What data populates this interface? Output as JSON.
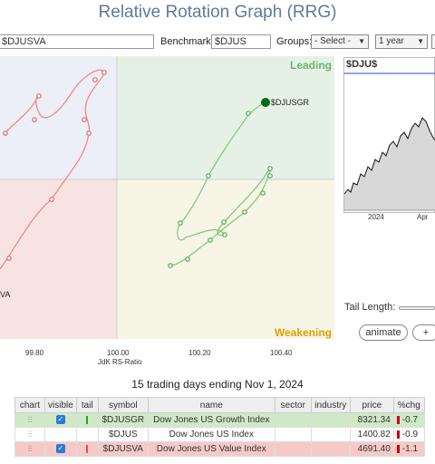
{
  "title": "Relative Rotation Graph (RRG)",
  "controls": {
    "symbols_value": "$DJUSVA",
    "benchmark_label": "Benchmark:",
    "benchmark_value": "$DJUS",
    "groups_label": "Groups:",
    "groups_value": "- Select -",
    "period_value": "1 year"
  },
  "quadrants": {
    "leading": "Leading",
    "weakening": "Weakening",
    "leading_color": "#6db36d",
    "weakening_color": "#d9a100"
  },
  "rrg": {
    "x_ticks": [
      "99.80",
      "100.00",
      "100.20",
      "100.40"
    ],
    "x_axis_label": "JdK RS-Ratio",
    "series_labels": {
      "growth": "$DJUSGR",
      "value": "VA"
    },
    "growth_color": "#5cb85c",
    "value_color": "#e86a6a"
  },
  "price_panel": {
    "symbol": "$DJU$",
    "x_ticks": [
      "2024",
      "Apr"
    ]
  },
  "tail_length_label": "Tail Length:",
  "buttons": {
    "animate": "animate",
    "plus": "+"
  },
  "summary": "15 trading days ending Nov 1, 2024",
  "table": {
    "headers": [
      "chart",
      "visible",
      "tail",
      "symbol",
      "name",
      "sector",
      "industry",
      "price",
      "%chg"
    ],
    "rows": [
      {
        "symbol": "$DJUSGR",
        "name": "Dow Jones US Growth Index",
        "sector": "",
        "industry": "",
        "price": "8321.34",
        "chg": "-0.7",
        "visible": true,
        "tail_color": "#2e9e2e"
      },
      {
        "symbol": "$DJUS",
        "name": "Dow Jones US Index",
        "sector": "",
        "industry": "",
        "price": "1400.82",
        "chg": "-0.9",
        "visible": false,
        "tail_color": ""
      },
      {
        "symbol": "$DJUSVA",
        "name": "Dow Jones US Value Index",
        "sector": "",
        "industry": "",
        "price": "4691.40",
        "chg": "-1.1",
        "visible": true,
        "tail_color": "#d9534f"
      }
    ]
  }
}
